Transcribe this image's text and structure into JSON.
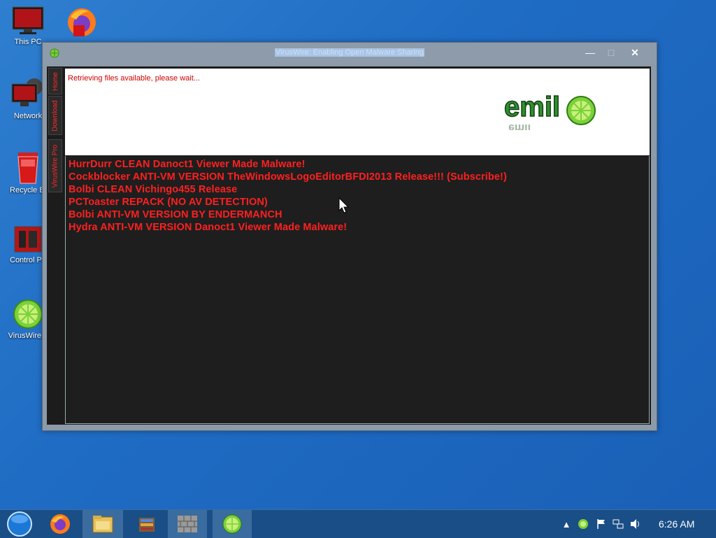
{
  "desktop": {
    "icons": [
      {
        "label": "This PC",
        "icon": "monitor-icon"
      },
      {
        "label": "",
        "icon": "firefox-app-icon"
      },
      {
        "label": "Network",
        "icon": "network-icon"
      },
      {
        "label": "Recycle Bi",
        "icon": "recycle-bin-icon"
      },
      {
        "label": "Control Pa",
        "icon": "control-panel-icon"
      },
      {
        "label": "VirusWire.e",
        "icon": "lime-icon"
      }
    ]
  },
  "window": {
    "title": "VirusWire: Enabling Open Malware Sharing",
    "controls": {
      "minimize": "—",
      "maximize": "□",
      "close": "✕"
    },
    "tabs": [
      "Home",
      "Download",
      "VirusWire Pro"
    ],
    "status": "Retrieving files available, please wait...",
    "logo_text": "emil",
    "files": [
      "HurrDurr CLEAN Danoct1 Viewer Made Malware!",
      "Cockblocker ANTI-VM VERSION TheWindowsLogoEditorBFDI2013 Release!!! (Subscribe!)",
      "Bolbi CLEAN Vichingo455 Release",
      "PCToaster REPACK (NO AV DETECTION)",
      "Bolbi ANTI-VM VERSION BY ENDERMANCH",
      "Hydra ANTI-VM VERSION Danoct1 Viewer Made Malware!"
    ],
    "colors": {
      "list_text": "#ff2020",
      "status_text": "#d10000",
      "logo_green": "#2f8f2f"
    }
  },
  "taskbar": {
    "buttons": [
      "start-orb",
      "firefox",
      "file-explorer",
      "winrar",
      "firewall",
      "viruswire"
    ],
    "clock": "6:26 AM"
  }
}
